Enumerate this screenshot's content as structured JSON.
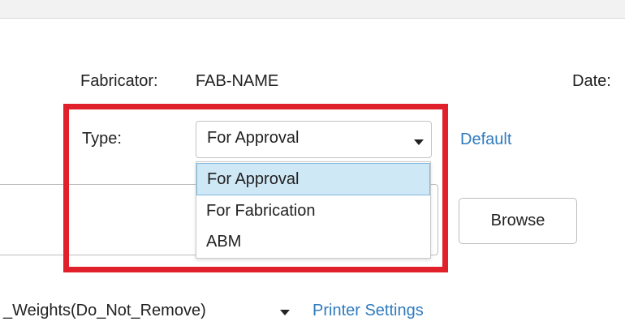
{
  "form": {
    "fabricator_label": "Fabricator:",
    "fabricator_value": "FAB-NAME",
    "date_label": "Date:",
    "type_label": "Type:",
    "type_selected": "For Approval",
    "type_options": [
      "For Approval",
      "For Fabrication",
      "ABM"
    ],
    "default_link": "Default",
    "browse_label": "Browse",
    "weights_selected": "_Weights(Do_Not_Remove)",
    "printer_settings_link": "Printer Settings"
  },
  "colors": {
    "highlight_border": "#e0202a",
    "link": "#2f7bbf",
    "selected_option_bg": "#cfe8f6"
  },
  "icons": {
    "type_caret": "chevron-down-icon",
    "weights_caret": "chevron-down-icon"
  }
}
